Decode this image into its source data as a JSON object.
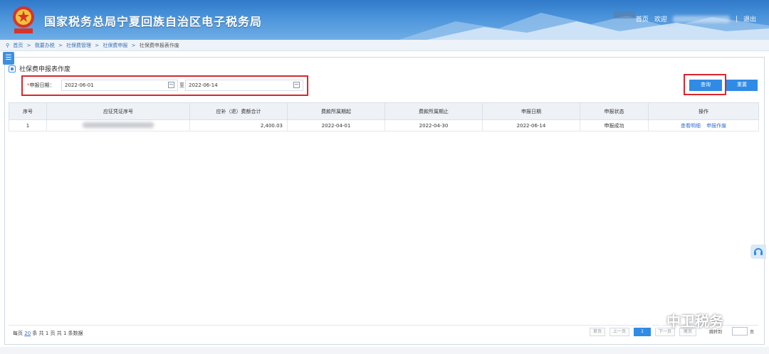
{
  "header": {
    "site_title": "国家税务总局宁夏回族自治区电子税务局",
    "nav_home": "首页",
    "nav_welcome": "欢迎",
    "nav_sep": "|",
    "nav_logout": "退出"
  },
  "breadcrumb": [
    "首页",
    ">",
    "我要办税",
    ">",
    "社保费管理",
    ">",
    "社保费申报",
    ">",
    "社保费申报表作废"
  ],
  "page": {
    "title": "社保费申报表作废"
  },
  "search": {
    "date_label_required": "*",
    "date_label": "申报日期：",
    "date_from": "2022-06-01",
    "date_sep": "至",
    "date_to": "2022-06-14",
    "query_button": "查询",
    "reset_button": "重置"
  },
  "table": {
    "headers": [
      "序号",
      "应征凭证序号",
      "应补（退）费额合计",
      "费款所属期起",
      "费款所属期止",
      "申报日期",
      "申报状态",
      "操作"
    ],
    "rows": [
      {
        "seq": "1",
        "amount": "2,400.03",
        "period_start": "2022-04-01",
        "period_end": "2022-04-30",
        "declare_date": "2022-06-14",
        "status": "申报成功",
        "op_view": "查看明细",
        "op_void": "申报作废"
      }
    ]
  },
  "pager": {
    "prefix": "每页",
    "page_size": "20",
    "mid": "条 共 1 页",
    "total": "共 1 条数据",
    "first": "首页",
    "prev": "上一页",
    "current": "1",
    "next": "下一页",
    "last": "尾页",
    "goto": "跳转到",
    "goto_suffix": "页"
  },
  "watermark": {
    "text": "中卫税务"
  },
  "colors": {
    "accent": "#2f8be6",
    "highlight": "#d9272d",
    "header": "#2f79c9"
  }
}
